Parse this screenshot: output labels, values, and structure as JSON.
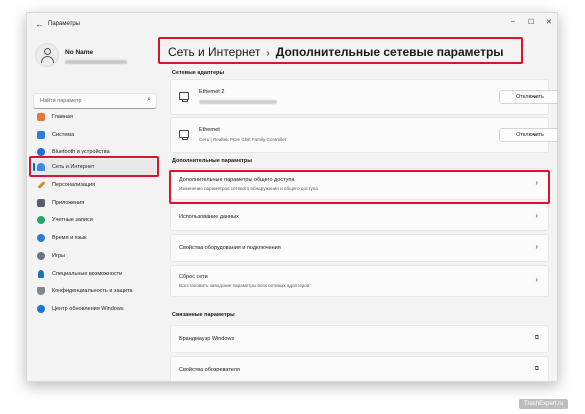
{
  "window": {
    "title": "Параметры",
    "controls": {
      "minimize": "–",
      "maximize": "☐",
      "close": "✕"
    },
    "back_glyph": "←"
  },
  "user": {
    "name": "No Name"
  },
  "search": {
    "placeholder": "Найти параметр",
    "icon": "search-icon"
  },
  "sidebar": {
    "items": [
      {
        "label": "Главная",
        "icon": "home-icon",
        "color": "#e07a3a"
      },
      {
        "label": "Система",
        "icon": "system-icon",
        "color": "#2f7fd1"
      },
      {
        "label": "Bluetooth и устройства",
        "icon": "bluetooth-icon",
        "color": "#1f6fcf"
      },
      {
        "label": "Сеть и Интернет",
        "icon": "network-icon",
        "color": "#3a8be0",
        "active": true
      },
      {
        "label": "Персонализация",
        "icon": "brush-icon",
        "color": "#d98a28"
      },
      {
        "label": "Приложения",
        "icon": "apps-icon",
        "color": "#55606e"
      },
      {
        "label": "Учетные записи",
        "icon": "accounts-icon",
        "color": "#2aa36b"
      },
      {
        "label": "Время и язык",
        "icon": "time-language-icon",
        "color": "#2d7bd0"
      },
      {
        "label": "Игры",
        "icon": "gaming-icon",
        "color": "#6b7480"
      },
      {
        "label": "Специальные возможности",
        "icon": "accessibility-icon",
        "color": "#1e6fc2"
      },
      {
        "label": "Конфиденциальность и защита",
        "icon": "shield-icon",
        "color": "#7d8590"
      },
      {
        "label": "Центр обновления Windows",
        "icon": "update-icon",
        "color": "#1f72d6"
      }
    ]
  },
  "breadcrumb": {
    "parent": "Сеть и Интернет",
    "separator": "›",
    "current": "Дополнительные сетевые параметры"
  },
  "sections": {
    "adapters": "Сетевые адаптеры",
    "additional": "Дополнительные параметры",
    "related": "Связанные параметры"
  },
  "adapters": [
    {
      "name": "Ethernet 2",
      "button": "Отключить"
    },
    {
      "name": "Ethernet",
      "description": "Сеть | Realtek PCIe GbE Family Controller",
      "button": "Отключить"
    }
  ],
  "additional": [
    {
      "title": "Дополнительные параметры общего доступа",
      "subtitle": "Изменение параметров сетевого обнаружения и общего доступа"
    },
    {
      "title": "Использование данных"
    },
    {
      "title": "Свойства оборудования и подключения"
    },
    {
      "title": "Сброс сети",
      "subtitle": "Восстановить заводские параметры всех сетевых адаптеров"
    }
  ],
  "related": [
    {
      "title": "Брандмауэр Windows"
    },
    {
      "title": "Свойства обозревателя"
    }
  ],
  "glyphs": {
    "chevron_right": "›",
    "chevron_down": "⌄",
    "external": "⧉"
  },
  "watermark": "TrashExpert.ru",
  "accent": "#0067c0",
  "highlight_color": "#d7162e"
}
